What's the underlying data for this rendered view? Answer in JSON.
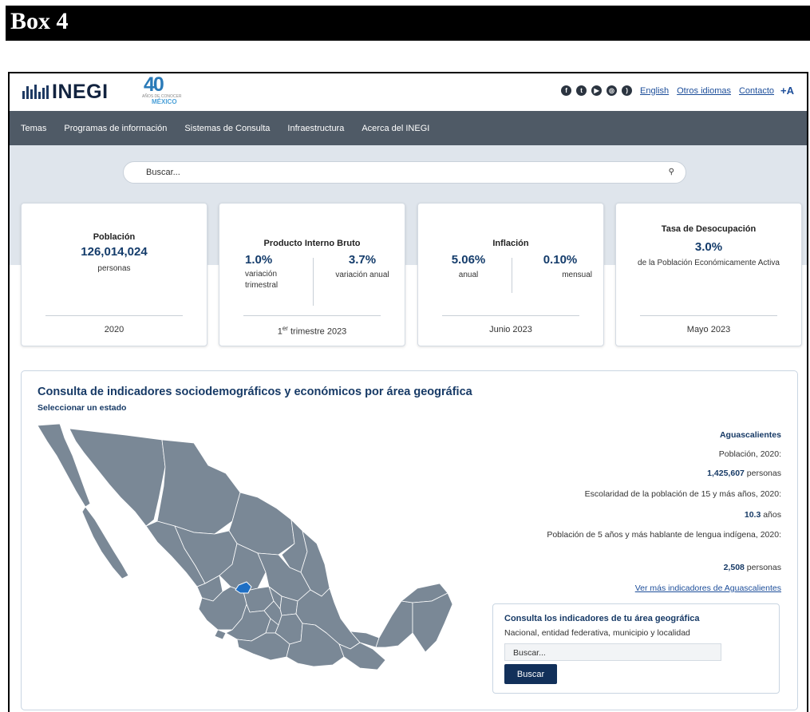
{
  "box_label": "Box 4",
  "header": {
    "logo_text": "INEGI",
    "anniversary_number": "40",
    "anniversary_small": "AÑOS DE CONOCER",
    "anniversary_country": "MÉXICO",
    "social_icons": [
      "facebook-icon",
      "twitter-icon",
      "youtube-icon",
      "instagram-icon",
      "rss-icon"
    ],
    "links": {
      "english": "English",
      "other_languages": "Otros idiomas",
      "contact": "Contacto",
      "font_size": "+A"
    }
  },
  "nav": {
    "items": [
      {
        "label": "Temas"
      },
      {
        "label": "Programas de información"
      },
      {
        "label": "Sistemas de Consulta"
      },
      {
        "label": "Infraestructura"
      },
      {
        "label": "Acerca del INEGI"
      }
    ]
  },
  "search": {
    "placeholder": "Buscar..."
  },
  "cards": {
    "poblacion": {
      "title": "Población",
      "value": "126,014,024",
      "unit": "personas",
      "footer": "2020"
    },
    "pib": {
      "title": "Producto Interno Bruto",
      "left_value": "1.0%",
      "left_label": "variación trimestral",
      "right_value": "3.7%",
      "right_label": "variación anual",
      "footer_prefix": "1",
      "footer_sup": "er",
      "footer_suffix": " trimestre 2023"
    },
    "inflacion": {
      "title": "Inflación",
      "left_value": "5.06%",
      "left_label": "anual",
      "right_value": "0.10%",
      "right_label": "mensual",
      "footer": "Junio 2023"
    },
    "desocupacion": {
      "title": "Tasa de Desocupación",
      "value": "3.0%",
      "description": "de la Población Económicamente Activa",
      "footer": "Mayo 2023"
    }
  },
  "geo_panel": {
    "title": "Consulta de indicadores sociodemográficos y económicos por área geográfica",
    "subtitle": "Seleccionar un estado",
    "state": "Aguascalientes",
    "population_label": "Población, 2020:",
    "population_value": "1,425,607",
    "population_unit": "personas",
    "schooling_label": "Escolaridad de la población de 15 y más años, 2020:",
    "schooling_value": "10.3",
    "schooling_unit": "años",
    "indigenous_label": "Población de 5 años y más hablante de lengua indígena, 2020:",
    "indigenous_value": "2,508",
    "indigenous_unit": "personas",
    "more_link": "Ver más indicadores de Aguascalientes",
    "map_color": "#7a8896",
    "highlight_color": "#1f6fc4"
  },
  "consult": {
    "title": "Consulta los indicadores de tu área geográfica",
    "subtitle": "Nacional, entidad federativa, municipio y localidad",
    "input_value": "Buscar...",
    "button_label": "Buscar"
  }
}
